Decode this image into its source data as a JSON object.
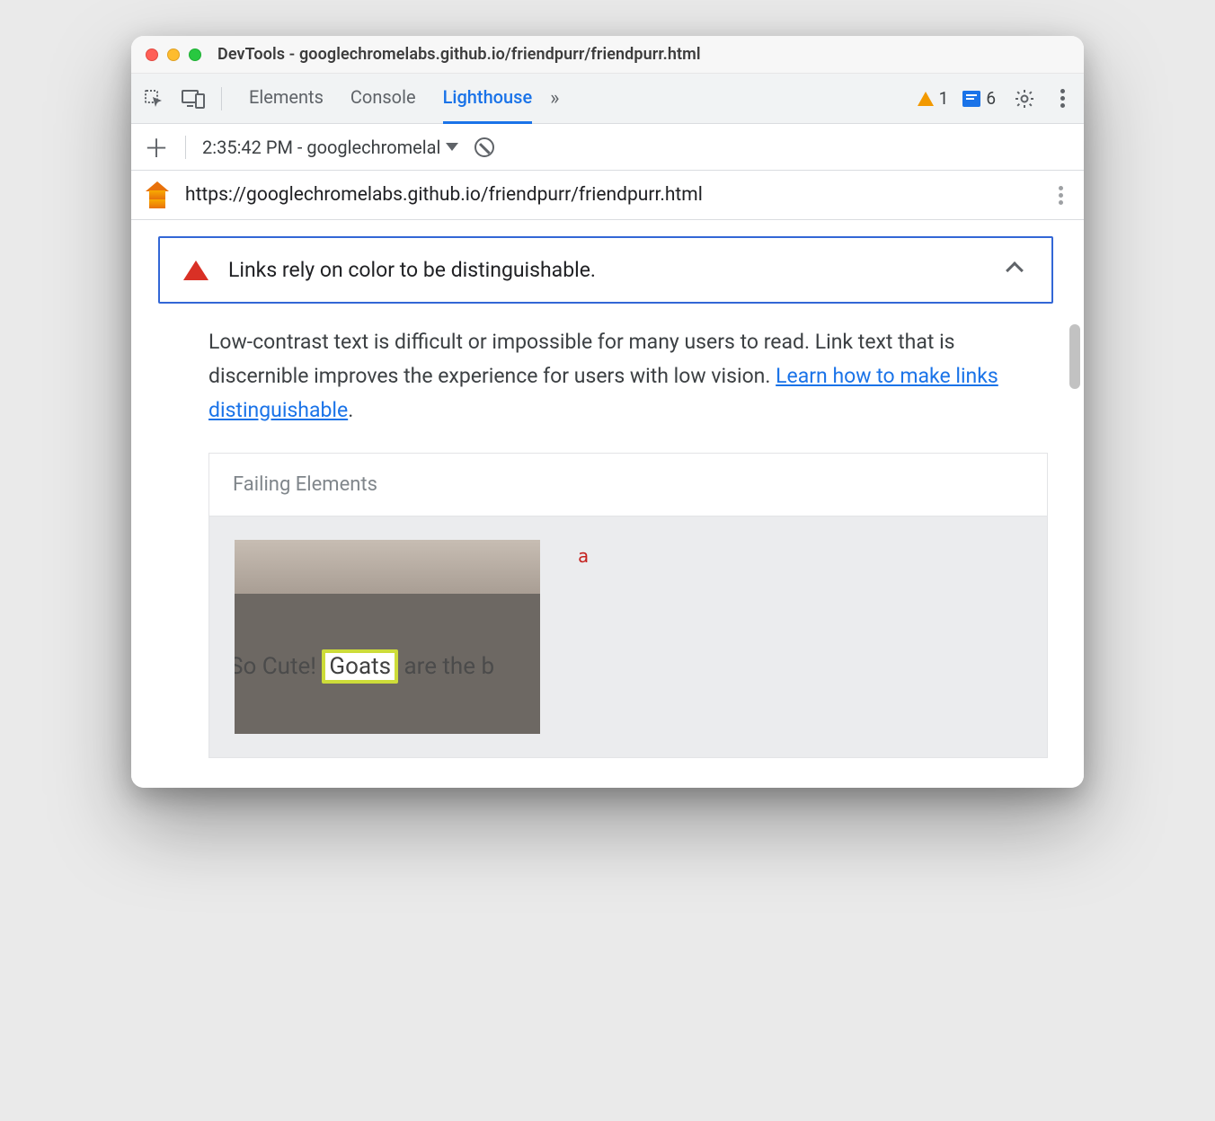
{
  "window": {
    "title": "DevTools - googlechromelabs.github.io/friendpurr/friendpurr.html"
  },
  "toolbar": {
    "tabs": {
      "elements": "Elements",
      "console": "Console",
      "lighthouse": "Lighthouse"
    },
    "overflow": "»",
    "warnings_count": "1",
    "messages_count": "6"
  },
  "subbar": {
    "report_label": "2:35:42 PM - googlechromelal"
  },
  "lighthouse": {
    "url": "https://googlechromelabs.github.io/friendpurr/friendpurr.html"
  },
  "audit": {
    "title": "Links rely on color to be distinguishable.",
    "description_pre": "Low-contrast text is difficult or impossible for many users to read. Link text that is discernible improves the experience for users with low vision. ",
    "learn_link": "Learn how to make links distinguishable",
    "description_post": "."
  },
  "failing": {
    "heading": "Failing Elements",
    "tag": "a",
    "snippet_pre": "So Cute! ",
    "snippet_hl": "Goats",
    "snippet_post": " are the b"
  }
}
